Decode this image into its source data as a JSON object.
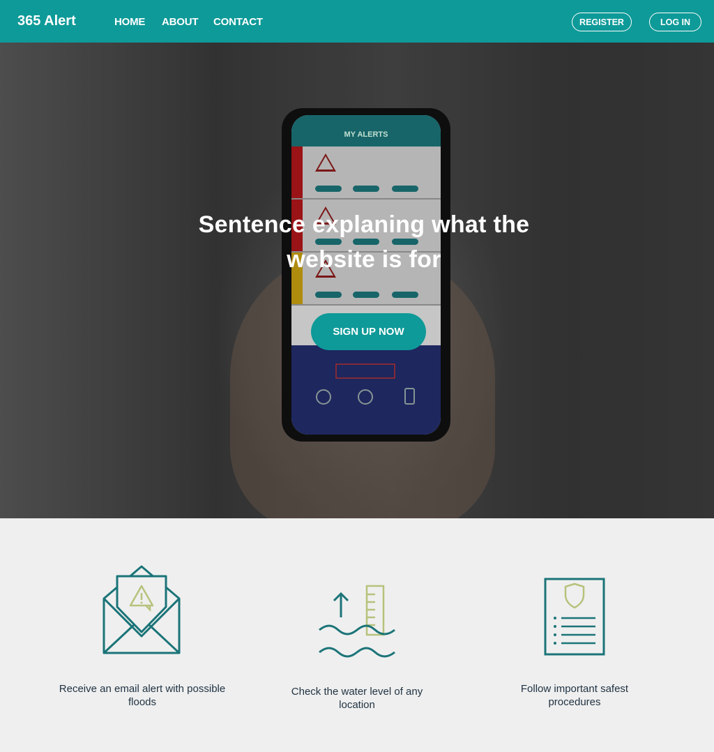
{
  "nav": {
    "brand": "365 Alert",
    "links": [
      "HOME",
      "ABOUT",
      "CONTACT"
    ],
    "register": "REGISTER",
    "login": "LOG IN"
  },
  "hero": {
    "title": "Sentence explaning what the website is for",
    "cta": "SIGN UP NOW",
    "phone": {
      "header": "MY ALERTS"
    }
  },
  "features": [
    {
      "icon": "email-alert-icon",
      "text": "Receive an email alert with possible floods"
    },
    {
      "icon": "water-level-icon",
      "text": "Check the water level of any location"
    },
    {
      "icon": "safety-procedures-icon",
      "text": "Follow important safest procedures"
    }
  ],
  "colors": {
    "accent": "#0e9a98",
    "icon_primary": "#1b7478",
    "icon_secondary": "#b7c27c",
    "text_dark": "#1f3242",
    "section_bg": "#efefef"
  }
}
